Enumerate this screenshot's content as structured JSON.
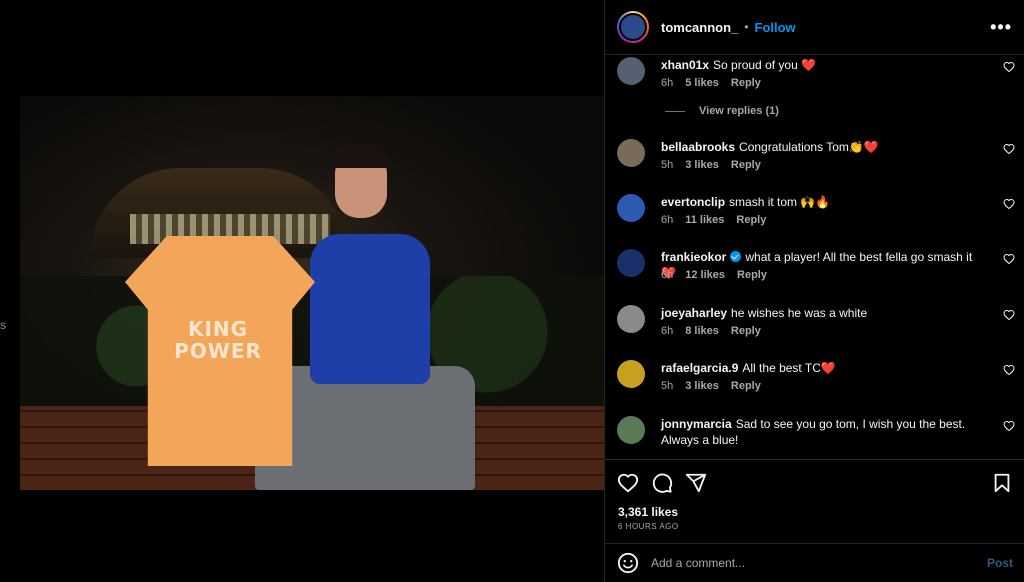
{
  "header": {
    "username": "tomcannon_",
    "separator": "•",
    "follow_label": "Follow",
    "more_icon": "more-horizontal-icon"
  },
  "comments": [
    {
      "username": "xhan01x",
      "text": "So proud of you ❤️",
      "time": "6h",
      "likes": "5 likes",
      "reply": "Reply",
      "verified": false,
      "avatar_color": "#556070"
    },
    {
      "username": "bellaabrooks",
      "text": "Congratulations Tom👏❤️",
      "time": "5h",
      "likes": "3 likes",
      "reply": "Reply",
      "verified": false,
      "avatar_color": "#7a6a5a"
    },
    {
      "username": "evertonclip",
      "text": "smash it tom 🙌🔥",
      "time": "6h",
      "likes": "11 likes",
      "reply": "Reply",
      "verified": false,
      "avatar_color": "#2a5bb0"
    },
    {
      "username": "frankieokor",
      "text": "what a player! All the best fella go smash it❤️",
      "time": "6h",
      "likes": "12 likes",
      "reply": "Reply",
      "verified": true,
      "avatar_color": "#1b2f6a"
    },
    {
      "username": "joeyaharley",
      "text": "he wishes he was a white",
      "time": "6h",
      "likes": "8 likes",
      "reply": "Reply",
      "verified": false,
      "avatar_color": "#8a8a8a"
    },
    {
      "username": "rafaelgarcia.9",
      "text": "All the best TC❤️",
      "time": "5h",
      "likes": "3 likes",
      "reply": "Reply",
      "verified": false,
      "avatar_color": "#c8a020"
    },
    {
      "username": "jonnymarcia",
      "text": "Sad to see you go tom, I wish you the best. Always a blue!",
      "time": "",
      "likes": "",
      "reply": "",
      "verified": false,
      "avatar_color": "#5a7a5a"
    }
  ],
  "view_replies": "View replies (1)",
  "photo": {
    "shirt_text": "KING POWER",
    "left_edge_text": "s"
  },
  "actions": {
    "likes": "3,361 likes",
    "time": "6 HOURS AGO"
  },
  "add_comment": {
    "placeholder": "Add a comment...",
    "post_label": "Post"
  },
  "colors": {
    "accent": "#0095f6",
    "post_disabled": "#315a7c",
    "background": "#000000",
    "divider": "#262626"
  }
}
